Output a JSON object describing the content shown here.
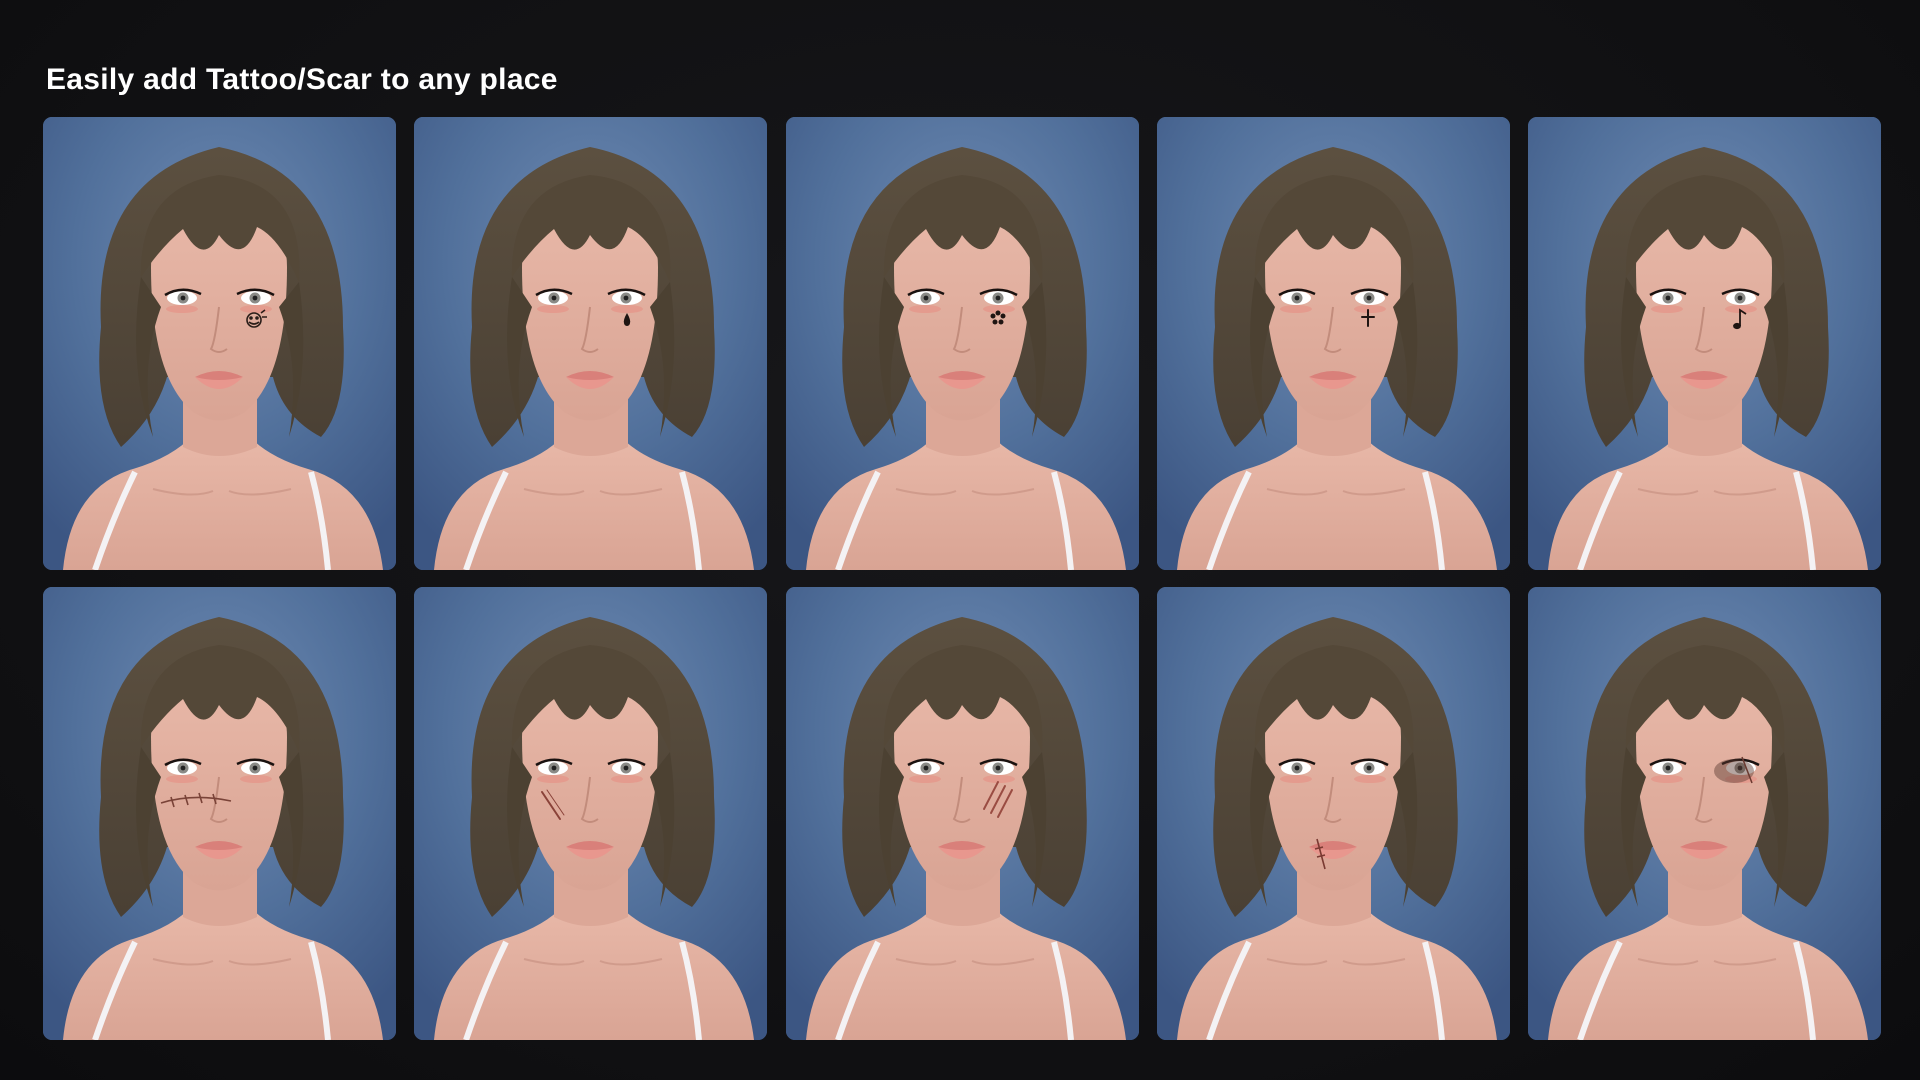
{
  "header": {
    "title": "Easily add Tattoo/Scar to any place"
  },
  "colors": {
    "page_background": "#121214",
    "card_background": "#4f6b96",
    "hair": "#4a4034",
    "skin": "#e8b8a8",
    "title_text": "#ffffff"
  },
  "gallery": {
    "items": [
      {
        "kind": "tattoo",
        "mark": "smiley-doodle-icon",
        "location": "right-cheek"
      },
      {
        "kind": "tattoo",
        "mark": "teardrop-icon",
        "location": "right-cheek"
      },
      {
        "kind": "tattoo",
        "mark": "flower-icon",
        "location": "right-cheek"
      },
      {
        "kind": "tattoo",
        "mark": "cross-star-icon",
        "location": "right-cheek"
      },
      {
        "kind": "tattoo",
        "mark": "music-note-icon",
        "location": "right-cheek"
      },
      {
        "kind": "scar",
        "mark": "stitched-scar-icon",
        "location": "nose-bridge"
      },
      {
        "kind": "scar",
        "mark": "cheek-slash-icon",
        "location": "left-cheek"
      },
      {
        "kind": "scar",
        "mark": "claw-marks-icon",
        "location": "right-cheek"
      },
      {
        "kind": "scar",
        "mark": "lip-scar-icon",
        "location": "mouth-corner"
      },
      {
        "kind": "scar",
        "mark": "eye-bruise-icon",
        "location": "right-eye"
      }
    ]
  }
}
